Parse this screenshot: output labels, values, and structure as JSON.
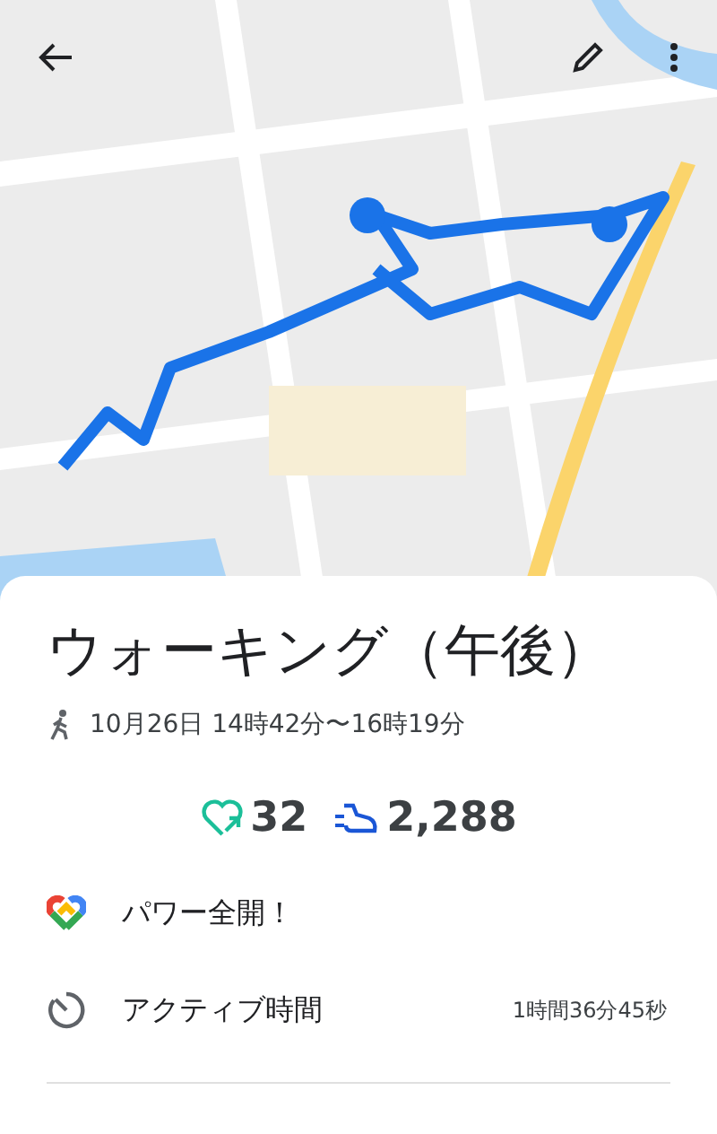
{
  "title": "ウォーキング（午後）",
  "date": "10月26日 14時42分〜16時19分",
  "stats": [
    {
      "kind": "heart",
      "value": "32"
    },
    {
      "kind": "steps",
      "value": "2,288"
    }
  ],
  "rows": [
    {
      "kind": "goal",
      "label": "パワー全開！"
    },
    {
      "kind": "active_time",
      "label": "アクティブ時間",
      "value": "1時間36分45秒"
    }
  ]
}
